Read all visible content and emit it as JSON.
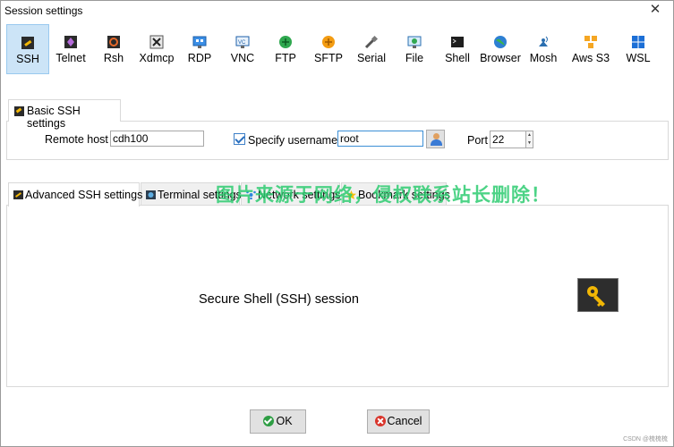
{
  "window": {
    "title": "Session settings",
    "close_glyph": "✕"
  },
  "session_types": [
    {
      "label": "SSH",
      "icon": "ssh-icon",
      "selected": true
    },
    {
      "label": "Telnet",
      "icon": "telnet-icon"
    },
    {
      "label": "Rsh",
      "icon": "rsh-icon"
    },
    {
      "label": "Xdmcp",
      "icon": "xdmcp-icon"
    },
    {
      "label": "RDP",
      "icon": "rdp-icon"
    },
    {
      "label": "VNC",
      "icon": "vnc-icon"
    },
    {
      "label": "FTP",
      "icon": "ftp-icon"
    },
    {
      "label": "SFTP",
      "icon": "sftp-icon"
    },
    {
      "label": "Serial",
      "icon": "serial-icon"
    },
    {
      "label": "File",
      "icon": "file-icon"
    },
    {
      "label": "Shell",
      "icon": "shell-icon"
    },
    {
      "label": "Browser",
      "icon": "browser-icon"
    },
    {
      "label": "Mosh",
      "icon": "mosh-icon"
    },
    {
      "label": "Aws S3",
      "icon": "aws-s3-icon"
    },
    {
      "label": "WSL",
      "icon": "wsl-icon"
    }
  ],
  "basic": {
    "tab_label": "Basic SSH settings",
    "remote_host_label": "Remote host *",
    "remote_host_value": "cdh100",
    "specify_username_label": "Specify username",
    "specify_username_checked": true,
    "username_value": "root",
    "port_label": "Port",
    "port_value": "22"
  },
  "advanced_tabs": [
    {
      "label": "Advanced SSH settings",
      "icon": "advanced-ssh-icon",
      "active": true
    },
    {
      "label": "Terminal settings",
      "icon": "terminal-icon"
    },
    {
      "label": "Network settings",
      "icon": "network-icon"
    },
    {
      "label": "Bookmark settings",
      "icon": "bookmark-star-icon"
    }
  ],
  "panel": {
    "description": "Secure Shell (SSH) session"
  },
  "watermark": "图片来源于网络，侵权联系站长删除！",
  "buttons": {
    "ok": "OK",
    "cancel": "Cancel"
  },
  "footer": {
    "csdn": "CSDN @梳梳梳"
  },
  "colors": {
    "selected_bg": "#cce4f7",
    "watermark": "#2ecc71",
    "key_panel": "#2d2d2d"
  }
}
